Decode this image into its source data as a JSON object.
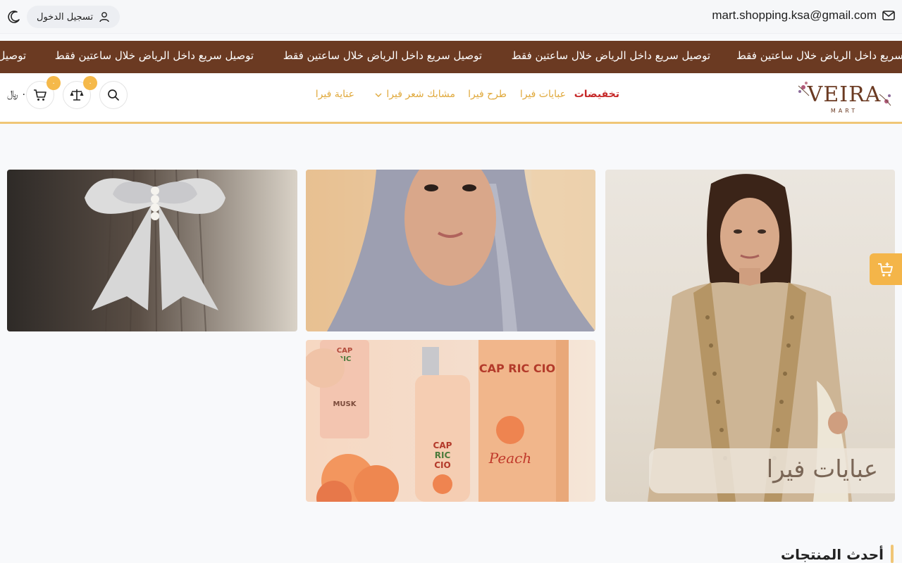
{
  "topbar": {
    "email": "mart.shopping.ksa@gmail.com",
    "login_label": "تسجيل الدخول"
  },
  "marquee": {
    "items": [
      "أسريع داخل الرياض خلال ساعتين فقط",
      "توصيل سريع داخل الرياض خلال ساعتين فقط",
      "توصيل سريع داخل الرياض خلال ساعتين فقط",
      "توصيل سريع داخل الرياض خلال ساعتين فقط",
      "توصيل"
    ]
  },
  "header": {
    "logo_text": "VEIRA",
    "logo_sub": "MART",
    "nav": {
      "sale": "تخفيضات",
      "abayas": "عبايات فيرا",
      "scarves": "طرح فيرا",
      "hair_clips": "مشابك شعر فيرا",
      "care": "عناية فيرا"
    },
    "compare_count": "٠",
    "cart_count": "٠",
    "cart_total": "٠ ﷼",
    "colors": {
      "accent": "#f0c676",
      "sale": "#c62828",
      "marquee_bg": "#6b3a22",
      "nav": "#e0a93c"
    }
  },
  "banners": {
    "abaya_caption": "عبايات فيرا",
    "perfume_brand": "CAP RIC CIO",
    "perfume_flavor": "Peach",
    "perfume_musk": "MUSK"
  },
  "sections": {
    "latest_title": "أحدث المنتجات"
  },
  "icons": {
    "mail": "mail-icon",
    "user": "user-icon",
    "moon": "moon-icon",
    "search": "search-icon",
    "compare": "scale-icon",
    "cart": "cart-icon",
    "chevron": "chevron-down-icon",
    "side_cart": "cart-add-icon"
  }
}
